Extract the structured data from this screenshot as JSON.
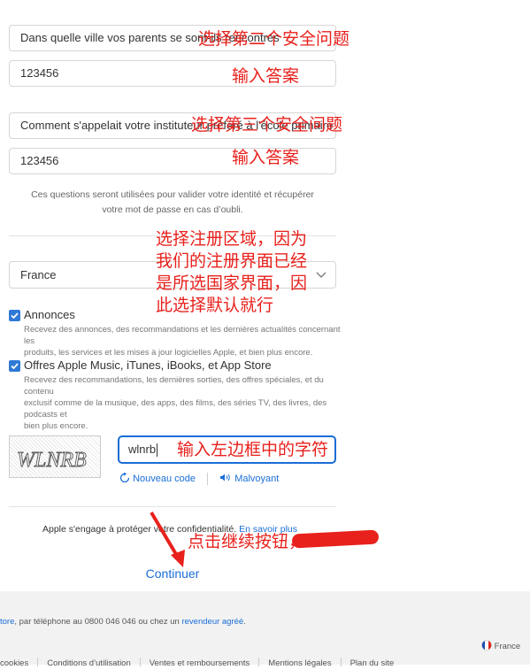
{
  "security": {
    "question2": "Dans quelle ville vos parents se sont-ils rencontrés",
    "answer2": "123456",
    "question3": "Comment s'appelait votre instituteur préféré à l'école primaire ?",
    "answer3": "123456",
    "help_line1": "Ces questions seront utilisées pour valider votre identité et récupérer",
    "help_line2": "votre mot de passe en cas d’oubli."
  },
  "region": {
    "selected": "France"
  },
  "subscriptions": [
    {
      "label": "Annonces",
      "desc_line1": "Recevez des annonces, des recommandations et les dernières actualités concernant les",
      "desc_line2": "produits, les services et les mises à jour logicielles Apple, et bien plus encore.",
      "desc_line3": "",
      "checked": true
    },
    {
      "label": "Offres Apple Music, iTunes, iBooks, et App Store",
      "desc_line1": "Recevez des recommandations, les dernières sorties, des offres spéciales, et du contenu",
      "desc_line2": "exclusif comme de la musique, des apps, des films, des séries TV, des livres, des podcasts et",
      "desc_line3": "bien plus encore.",
      "checked": true
    }
  ],
  "captcha": {
    "image_text": "WLNRB",
    "input_value": "wlnrb",
    "new_code": "Nouveau code",
    "audio": "Malvoyant"
  },
  "privacy": {
    "text": "Apple s'engage à protéger votre confidentialité.",
    "link": "En savoir plus"
  },
  "continue_label": "Continuer",
  "annotations": {
    "q2": "选择第二个安全问题",
    "a2": "输入答案",
    "q3": "选择第三个安全问题",
    "a3": "输入答案",
    "region_line1": "选择注册区域，因为",
    "region_line2": "我们的注册界面已经",
    "region_line3": "是所选国家界面，因",
    "region_line4": "此选择默认就行",
    "captcha": "输入左边框中的字符",
    "continue": "点击继续按钮，"
  },
  "footer": {
    "contact_prefix": "tore",
    "contact_mid": ", par téléphone au 0800 046 046 ou chez un ",
    "contact_link": "revendeur agréé",
    "contact_suffix": ".",
    "country": "France",
    "links": [
      "cookies",
      "Conditions d’utilisation",
      "Ventes et remboursements",
      "Mentions légales",
      "Plan du site"
    ]
  },
  "colors": {
    "accent": "#1a6dd6",
    "annotation": "#e8211c",
    "checkbox": "#2f79d6"
  }
}
